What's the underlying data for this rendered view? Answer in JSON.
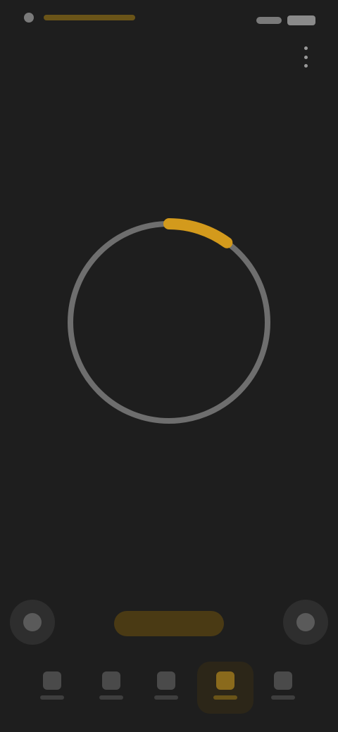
{
  "page": {
    "title": "",
    "time_display": ""
  },
  "timer": {
    "progress_fraction": 0.1,
    "accent_color": "#d39a1c",
    "track_color": "#6e6e6e"
  },
  "controls": {
    "start_label": ""
  },
  "colors": {
    "background": "#1e1e1e",
    "accent": "#d39a1c"
  },
  "icons": {
    "menu": "more-vertical-icon",
    "left_control": "reset-icon",
    "right_control": "settings-icon"
  },
  "bottom_nav": {
    "active_index": 3
  }
}
